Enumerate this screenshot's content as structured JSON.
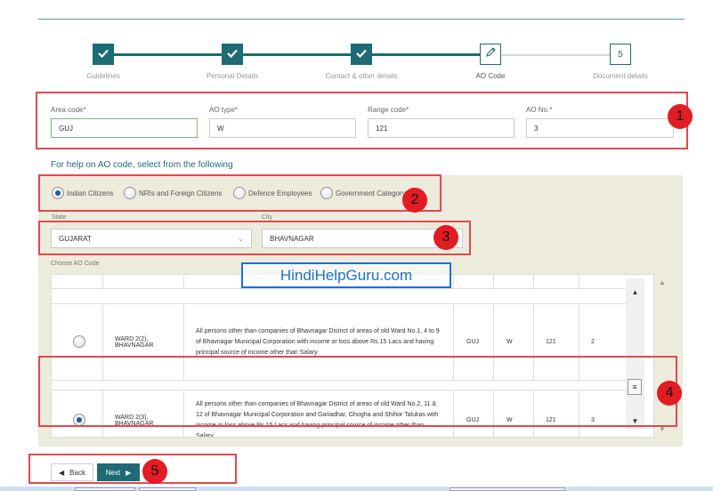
{
  "stepper": {
    "steps": [
      {
        "label": "Guidelines",
        "state": "done"
      },
      {
        "label": "Personal Details",
        "state": "done"
      },
      {
        "label": "Contact & other details",
        "state": "done"
      },
      {
        "label": "AO Code",
        "state": "current"
      },
      {
        "label": "Document details",
        "state": "todo",
        "number": "5"
      }
    ]
  },
  "fields": {
    "area_code": {
      "label": "Area code*",
      "value": "GUJ"
    },
    "ao_type": {
      "label": "AO type*",
      "value": "W"
    },
    "range_code": {
      "label": "Range code*",
      "value": "121"
    },
    "ao_no": {
      "label": "AO No.*",
      "value": "3"
    }
  },
  "help_text": "For help on AO code, select from the following",
  "categories": [
    {
      "label": "Indian Citizens",
      "checked": true
    },
    {
      "label": "NRIs and Foreign Citizens",
      "checked": false
    },
    {
      "label": "Defence Employees",
      "checked": false
    },
    {
      "label": "Government Category",
      "checked": false
    }
  ],
  "state": {
    "label": "State",
    "value": "GUJARAT"
  },
  "city": {
    "label": "City",
    "value": "BHAVNAGAR"
  },
  "choose_label": "Choose AO Code",
  "rows": [
    {
      "ward": "WARD 2(2), BHAVNAGAR",
      "description": "All persons other than companies of Bhavnagar District of areas of old Ward No.1, 4 to 9 of Bhavnagar Municipal Corporation with income or loss above Rs.15 Lacs and having principal source of income other than Salary.",
      "area": "GUJ",
      "type": "W",
      "range": "121",
      "no": "2",
      "selected": false
    },
    {
      "ward": "WARD 2(3), BHAVNAGAR",
      "description": "All persons other than companies of Bhavnagar District of areas of old Ward No.2, 11 & 12 of Bhavnagar Municipal Corporation and Gariadhar, Ghogha and Shihor Talukas with income or loss above Rs.15 Lacs and having principal source of income other than Salary.",
      "area": "GUJ",
      "type": "W",
      "range": "121",
      "no": "3",
      "selected": true
    }
  ],
  "watermark": "HindiHelpGuru.com",
  "buttons": {
    "back": "Back",
    "next": "Next"
  },
  "badges": [
    "1",
    "2",
    "3",
    "4",
    "5"
  ],
  "colors": {
    "accent": "#1d6b74",
    "annotation_red": "#e31b23",
    "panel_bg": "#ecebdc"
  }
}
